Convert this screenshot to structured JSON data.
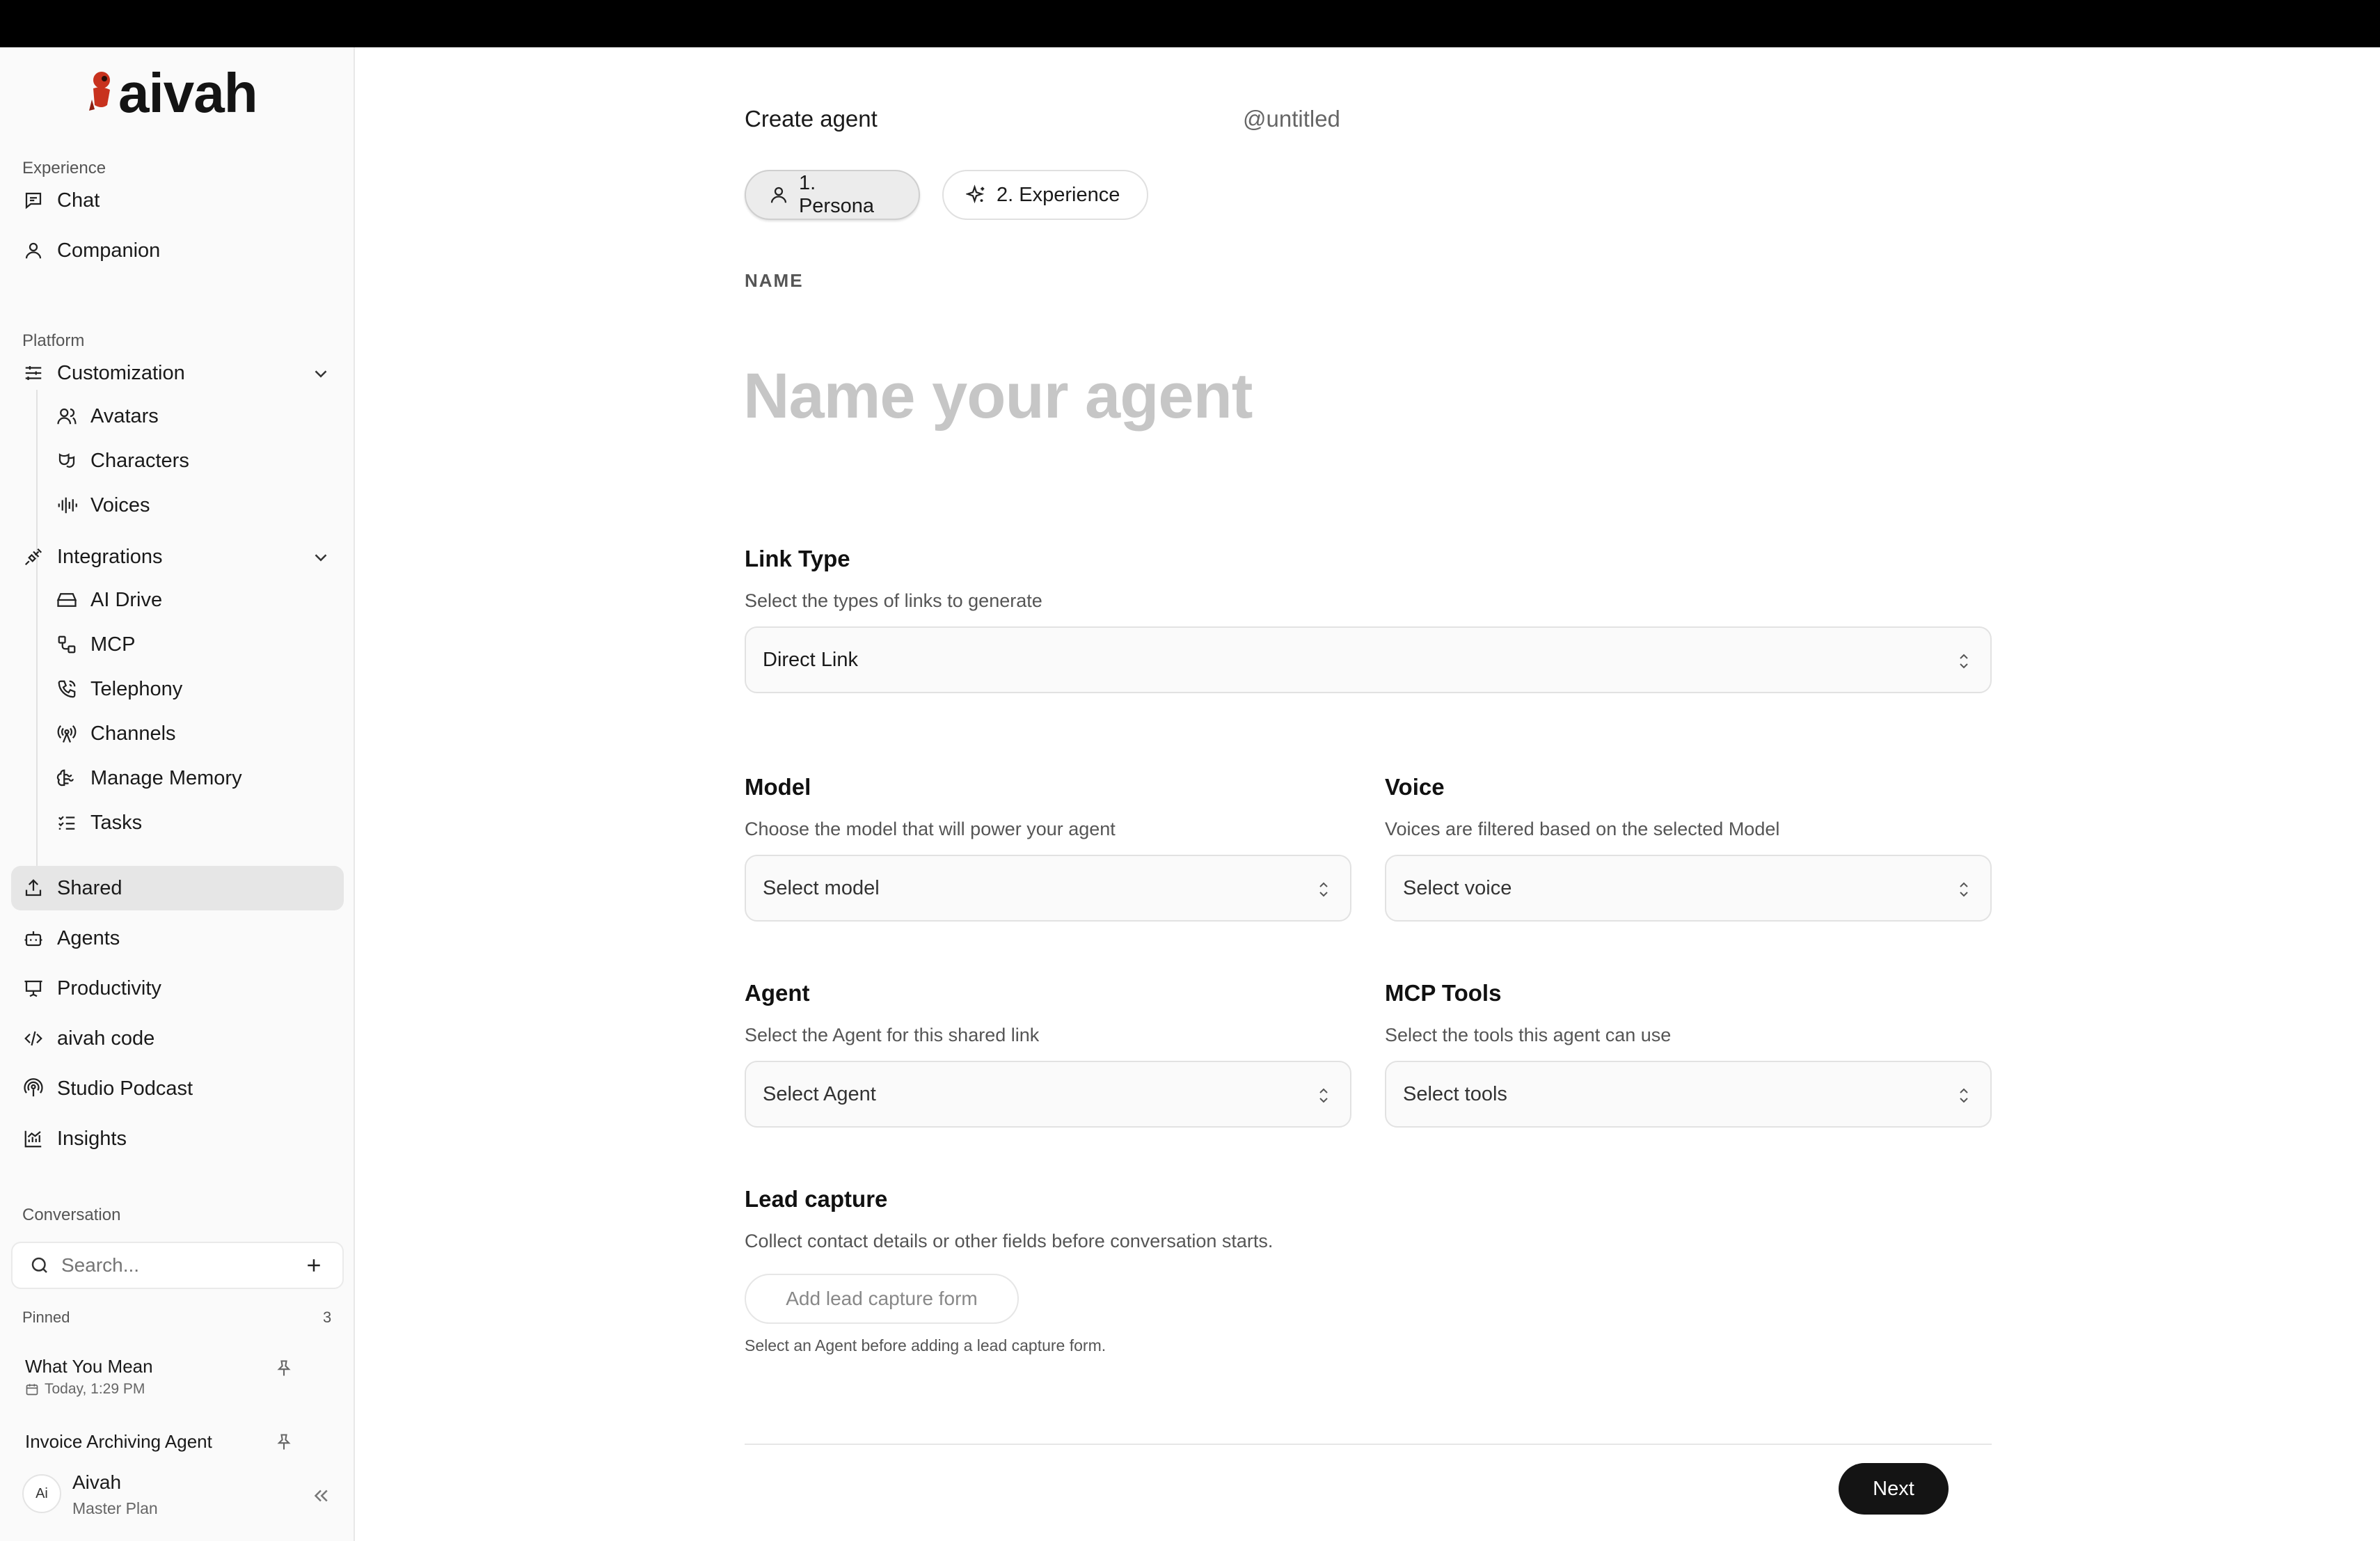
{
  "app": {
    "logo_text": "aivah"
  },
  "sidebar": {
    "experience_label": "Experience",
    "experience_items": [
      {
        "label": "Chat",
        "icon": "chat-icon"
      },
      {
        "label": "Companion",
        "icon": "user-icon"
      }
    ],
    "platform_label": "Platform",
    "customization": {
      "label": "Customization",
      "expanded": true,
      "children": [
        {
          "label": "Avatars",
          "icon": "users-icon"
        },
        {
          "label": "Characters",
          "icon": "theater-icon"
        },
        {
          "label": "Voices",
          "icon": "audio-lines-icon"
        }
      ]
    },
    "integrations": {
      "label": "Integrations",
      "expanded": true,
      "children": [
        {
          "label": "AI Drive",
          "icon": "hard-drive-icon"
        },
        {
          "label": "MCP",
          "icon": "workflow-icon"
        },
        {
          "label": "Telephony",
          "icon": "phone-icon"
        },
        {
          "label": "Channels",
          "icon": "radio-tower-icon"
        },
        {
          "label": "Manage Memory",
          "icon": "brain-icon"
        },
        {
          "label": "Tasks",
          "icon": "list-checks-icon"
        }
      ]
    },
    "platform_items": [
      {
        "label": "Shared",
        "icon": "share-icon",
        "active": true
      },
      {
        "label": "Agents",
        "icon": "bot-icon"
      },
      {
        "label": "Productivity",
        "icon": "presentation-icon"
      },
      {
        "label": "aivah code",
        "icon": "code-icon"
      },
      {
        "label": "Studio Podcast",
        "icon": "podcast-icon"
      },
      {
        "label": "Insights",
        "icon": "chart-icon"
      }
    ],
    "conversation_label": "Conversation",
    "search_placeholder": "Search...",
    "pinned_label": "Pinned",
    "pinned_count": "3",
    "pinned": [
      {
        "title": "What You Mean",
        "date": "Today, 1:29 PM"
      },
      {
        "title": "Invoice Archiving Agent"
      }
    ],
    "user": {
      "initials": "Ai",
      "name": "Aivah",
      "plan": "Master Plan"
    }
  },
  "main": {
    "title": "Create agent",
    "handle": "@untitled",
    "steps": [
      {
        "label": "1. Persona",
        "active": true,
        "icon": "user-icon"
      },
      {
        "label": "2. Experience",
        "active": false,
        "icon": "sparkles-icon"
      }
    ],
    "name_label": "NAME",
    "name_placeholder": "Name your agent",
    "name_value": "",
    "link_type": {
      "title": "Link Type",
      "desc": "Select the types of links to generate",
      "value": "Direct Link"
    },
    "model": {
      "title": "Model",
      "desc": "Choose the model that will power your agent",
      "value": "Select model"
    },
    "voice": {
      "title": "Voice",
      "desc": "Voices are filtered based on the selected Model",
      "value": "Select voice"
    },
    "agent": {
      "title": "Agent",
      "desc": "Select the Agent for this shared link",
      "value": "Select Agent"
    },
    "mcp_tools": {
      "title": "MCP Tools",
      "desc": "Select the tools this agent can use",
      "value": "Select tools"
    },
    "lead_capture": {
      "title": "Lead capture",
      "desc": "Collect contact details or other fields before conversation starts.",
      "button": "Add lead capture form",
      "hint": "Select an Agent before adding a lead capture form."
    },
    "next_label": "Next"
  },
  "colors": {
    "accent": "#141414",
    "active_bg": "#e6e6e6",
    "logo_mascot": "#c8321e"
  }
}
